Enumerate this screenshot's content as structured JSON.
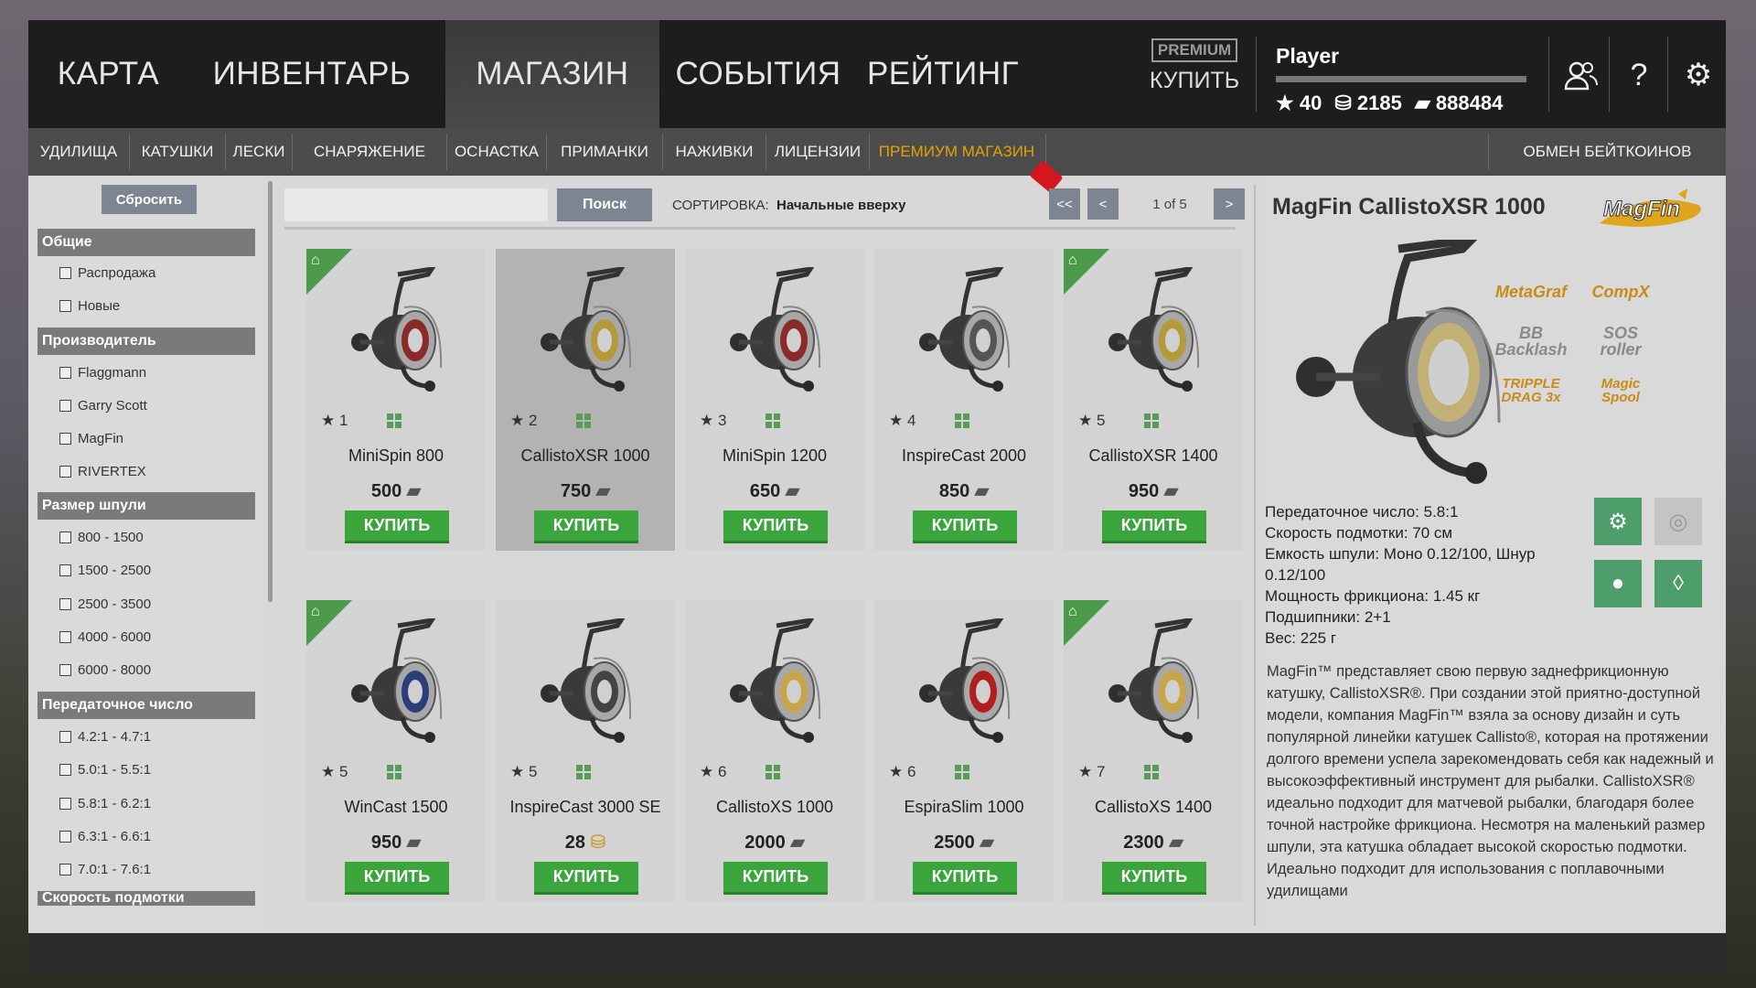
{
  "nav": {
    "items": [
      {
        "label": "КАРТА",
        "name": "nav-map"
      },
      {
        "label": "ИНВЕНТАРЬ",
        "name": "nav-inventory"
      },
      {
        "label": "МАГАЗИН",
        "name": "nav-shop"
      },
      {
        "label": "СОБЫТИЯ",
        "name": "nav-events"
      },
      {
        "label": "РЕЙТИНГ",
        "name": "nav-rating"
      }
    ],
    "premium_badge": "PREMIUM",
    "premium_buy": "КУПИТЬ"
  },
  "player": {
    "name": "Player",
    "level": "40",
    "coins": "2185",
    "money": "888484",
    "star_icon": "★"
  },
  "subnav": {
    "items": [
      "УДИЛИЩА",
      "КАТУШКИ",
      "ЛЕСКИ",
      "СНАРЯЖЕНИЕ",
      "ОСНАСТКА",
      "ПРИМАНКИ",
      "НАЖИВКИ",
      "ЛИЦЕНЗИИ",
      "ПРЕМИУМ МАГАЗИН"
    ],
    "exchange": "ОБМЕН БЕЙТКОИНОВ"
  },
  "filters": {
    "reset": "Сбросить",
    "sections": {
      "general": "Общие",
      "maker": "Производитель",
      "spool": "Размер шпули",
      "ratio": "Передаточное число",
      "speed": "Скорость подмотки"
    },
    "general": [
      "Распродажа",
      "Новые"
    ],
    "maker": [
      "Flaggmann",
      "Garry Scott",
      "MagFin",
      "RIVERTEX"
    ],
    "spool": [
      "800 - 1500",
      "1500 - 2500",
      "2500 - 3500",
      "4000 - 6000",
      "6000 - 8000"
    ],
    "ratio": [
      "4.2:1 - 4.7:1",
      "5.0:1 - 5.5:1",
      "5.8:1 - 6.2:1",
      "6.3:1 - 6.6:1",
      "7.0:1 - 7.6:1"
    ]
  },
  "toolbar": {
    "search_button": "Поиск",
    "sort_label": "СОРТИРОВКА:",
    "sort_value": "Начальные вверху",
    "first": "<<",
    "prev": "<",
    "page": "1 of 5",
    "next": ">",
    "last": ">>"
  },
  "products": [
    {
      "name": "MiniSpin 800",
      "rank": "1",
      "price": "500",
      "currency": "money",
      "buy": "КУПИТЬ",
      "home": true,
      "color": "#8a2a2a"
    },
    {
      "name": "CallistoXSR 1000",
      "rank": "2",
      "price": "750",
      "currency": "money",
      "buy": "КУПИТЬ",
      "home": false,
      "color": "#b59a3a"
    },
    {
      "name": "MiniSpin 1200",
      "rank": "3",
      "price": "650",
      "currency": "money",
      "buy": "КУПИТЬ",
      "home": false,
      "color": "#8a2a2a"
    },
    {
      "name": "InspireCast 2000",
      "rank": "4",
      "price": "850",
      "currency": "money",
      "buy": "КУПИТЬ",
      "home": false,
      "color": "#555555"
    },
    {
      "name": "CallistoXSR 1400",
      "rank": "5",
      "price": "950",
      "currency": "money",
      "buy": "КУПИТЬ",
      "home": true,
      "color": "#b59a3a"
    },
    {
      "name": "WinCast 1500",
      "rank": "5",
      "price": "950",
      "currency": "money",
      "buy": "КУПИТЬ",
      "home": true,
      "color": "#2c3d7a"
    },
    {
      "name": "InspireCast 3000 SE",
      "rank": "5",
      "price": "28",
      "currency": "gold",
      "buy": "КУПИТЬ",
      "home": false,
      "color": "#444444"
    },
    {
      "name": "CallistoXS 1000",
      "rank": "6",
      "price": "2000",
      "currency": "money",
      "buy": "КУПИТЬ",
      "home": false,
      "color": "#c9a54a"
    },
    {
      "name": "EspiraSlim 1000",
      "rank": "6",
      "price": "2500",
      "currency": "money",
      "buy": "КУПИТЬ",
      "home": false,
      "color": "#b01e1e"
    },
    {
      "name": "CallistoXS 1400",
      "rank": "7",
      "price": "2300",
      "currency": "money",
      "buy": "КУПИТЬ",
      "home": true,
      "color": "#c9a54a"
    }
  ],
  "detail": {
    "title": "MagFin CallistoXSR 1000",
    "brand_logo": "MagFin",
    "tech_logos": [
      "MetaGraf",
      "CompX",
      "BB Backlash",
      "SOS roller",
      "TRIPPLE DRAG 3x",
      "Magic Spool"
    ],
    "specs": [
      "Передаточное число: 5.8:1",
      "Скорость подмотки: 70 см",
      "Емкость шпули: Моно 0.12/100, Шнур 0.12/100",
      "Мощность фрикциона: 1.45 кг",
      "Подшипники: 2+1",
      "Вес: 225 г"
    ],
    "description": "MagFin™ представляет свою первую заднефрикционную катушку, CallistoXSR®. При создании этой приятно-доступной модели, компания MagFin™ взяла за основу дизайн и суть популярной линейки катушек Callisto®, которая на протяжении долгого времени успела зарекомендовать себя как надежный и высокоэффективный инструмент для рыбалки. CallistoXSR® идеально подходит для матчевой рыбалки, благодаря более точной настройке фрикциона. Несмотря на маленький размер шпули, эта катушка обладает высокой скоростью подмотки. Идеально подходит для использования с поплавочными удилищами"
  }
}
